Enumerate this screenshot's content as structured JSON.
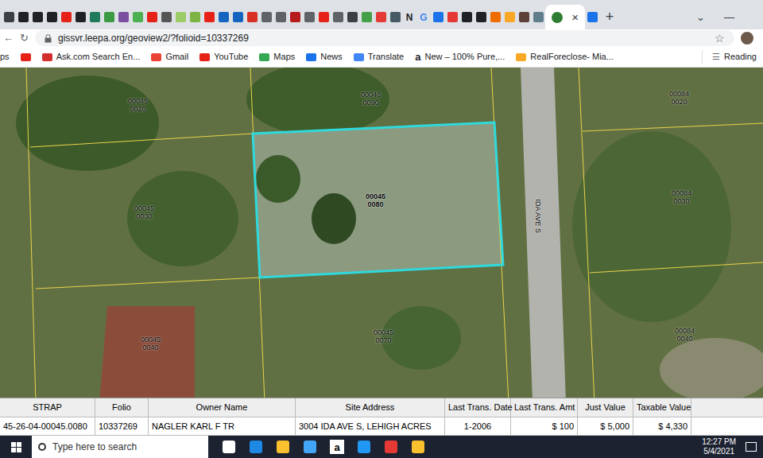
{
  "browser": {
    "tabs": [
      {
        "kind": "favicon",
        "glyph": "",
        "color": "#3c4043",
        "selected": false
      },
      {
        "kind": "favicon",
        "glyph": "",
        "color": "#202124",
        "selected": false
      },
      {
        "kind": "favicon",
        "glyph": "",
        "color": "#202124",
        "selected": false
      },
      {
        "kind": "favicon",
        "glyph": "",
        "color": "#202124",
        "selected": false
      },
      {
        "kind": "favicon",
        "glyph": "",
        "color": "#e62117",
        "selected": false
      },
      {
        "kind": "favicon",
        "glyph": "",
        "color": "#202124",
        "selected": false
      },
      {
        "kind": "favicon",
        "glyph": "",
        "color": "#1f7a5c",
        "selected": false
      },
      {
        "kind": "favicon",
        "glyph": "",
        "color": "#3b9a43",
        "selected": false
      },
      {
        "kind": "favicon",
        "glyph": "",
        "color": "#7b4fa0",
        "selected": false
      },
      {
        "kind": "favicon",
        "glyph": "",
        "color": "#4caf50",
        "selected": false
      },
      {
        "kind": "favicon",
        "glyph": "",
        "color": "#e62117",
        "selected": false
      },
      {
        "kind": "favicon",
        "glyph": "",
        "color": "#555555",
        "selected": false
      },
      {
        "kind": "favicon",
        "glyph": "",
        "color": "#9ccc65",
        "selected": false
      },
      {
        "kind": "favicon",
        "glyph": "",
        "color": "#7cb342",
        "selected": false
      },
      {
        "kind": "favicon",
        "glyph": "",
        "color": "#e62117",
        "selected": false
      },
      {
        "kind": "favicon",
        "glyph": "",
        "color": "#1565c0",
        "selected": false
      },
      {
        "kind": "favicon",
        "glyph": "",
        "color": "#1565c0",
        "selected": false
      },
      {
        "kind": "favicon",
        "glyph": "",
        "color": "#d93025",
        "selected": false
      },
      {
        "kind": "favicon",
        "glyph": "",
        "color": "#5f6368",
        "selected": false
      },
      {
        "kind": "favicon",
        "glyph": "",
        "color": "#5f6368",
        "selected": false
      },
      {
        "kind": "favicon",
        "glyph": "",
        "color": "#b71c1c",
        "selected": false
      },
      {
        "kind": "favicon",
        "glyph": "",
        "color": "#5f6368",
        "selected": false
      },
      {
        "kind": "favicon",
        "glyph": "",
        "color": "#e62117",
        "selected": false
      },
      {
        "kind": "favicon",
        "glyph": "",
        "color": "#5f6368",
        "selected": false
      },
      {
        "kind": "favicon",
        "glyph": "",
        "color": "#3c4043",
        "selected": false
      },
      {
        "kind": "favicon",
        "glyph": "",
        "color": "#43a047",
        "selected": false
      },
      {
        "kind": "favicon",
        "glyph": "",
        "color": "#e53935",
        "selected": false
      },
      {
        "kind": "favicon",
        "glyph": "",
        "color": "#455a64",
        "selected": false
      },
      {
        "kind": "letter",
        "glyph": "N",
        "color": "#202124",
        "selected": false
      },
      {
        "kind": "letter",
        "glyph": "G",
        "color": "#4285f4",
        "selected": false
      },
      {
        "kind": "favicon",
        "glyph": "",
        "color": "#1a73e8",
        "selected": false
      },
      {
        "kind": "favicon",
        "glyph": "",
        "color": "#e53935",
        "selected": false
      },
      {
        "kind": "favicon",
        "glyph": "",
        "color": "#202124",
        "selected": false
      },
      {
        "kind": "favicon",
        "glyph": "",
        "color": "#202124",
        "selected": false
      },
      {
        "kind": "favicon",
        "glyph": "",
        "color": "#ef6c00",
        "selected": false
      },
      {
        "kind": "favicon",
        "glyph": "",
        "color": "#f9a825",
        "selected": false
      },
      {
        "kind": "favicon",
        "glyph": "",
        "color": "#5d4037",
        "selected": false
      },
      {
        "kind": "favicon",
        "glyph": "",
        "color": "#607d8b",
        "selected": false
      },
      {
        "kind": "favicon",
        "glyph": "",
        "color": "#2e7d32",
        "selected": true
      },
      {
        "kind": "favicon",
        "glyph": "",
        "color": "#1a73e8",
        "selected": false
      }
    ],
    "close_glyph": "×",
    "new_tab": "+",
    "window_controls": [
      "⌄",
      "—"
    ]
  },
  "address_bar": {
    "url": "gissvr.leepa.org/geoview2/?folioid=10337269",
    "star": "☆"
  },
  "bookmarks": [
    {
      "kind": "text",
      "label": "ps",
      "color": "#5f6368"
    },
    {
      "kind": "icon",
      "label": "",
      "color": "#e62117"
    },
    {
      "kind": "icon",
      "label": "Ask.com Search En...",
      "color": "#d32f2f"
    },
    {
      "kind": "icon",
      "label": "Gmail",
      "color": "#ea4335"
    },
    {
      "kind": "icon",
      "label": "YouTube",
      "color": "#e62117"
    },
    {
      "kind": "icon",
      "label": "Maps",
      "color": "#34a853"
    },
    {
      "kind": "icon",
      "label": "News",
      "color": "#1a73e8"
    },
    {
      "kind": "icon",
      "label": "Translate",
      "color": "#4285f4"
    },
    {
      "kind": "letter",
      "label": "New – 100% Pure,...",
      "color": "#202124",
      "glyph": "a"
    },
    {
      "kind": "icon",
      "label": "RealForeclose- Mia...",
      "color": "#f9a825"
    }
  ],
  "reading_list": {
    "label": "Reading",
    "glyph": "☰"
  },
  "map": {
    "road_label": "IDA AVE S",
    "parcels": [
      {
        "lines": [
          "00045",
          "0020"
        ],
        "selected": false
      },
      {
        "lines": [
          "00046",
          "0090"
        ],
        "selected": false
      },
      {
        "lines": [
          "00045",
          "0030"
        ],
        "selected": false
      },
      {
        "lines": [
          "00045",
          "0080"
        ],
        "selected": true
      },
      {
        "lines": [
          "00045",
          "0040"
        ],
        "selected": false
      },
      {
        "lines": [
          "00045",
          "0070"
        ],
        "selected": false
      },
      {
        "lines": [
          "00084",
          "0020"
        ],
        "selected": false
      },
      {
        "lines": [
          "00084",
          "0030"
        ],
        "selected": false
      },
      {
        "lines": [
          "00084",
          "0040"
        ],
        "selected": false
      }
    ]
  },
  "table": {
    "columns": [
      "STRAP",
      "Folio",
      "Owner Name",
      "Site Address",
      "Last Trans. Date",
      "Last Trans. Amt",
      "Just Value",
      "Taxable Value"
    ],
    "rows": [
      [
        "45-26-04-00045.0080",
        "10337269",
        "NAGLER KARL F TR",
        "3004 IDA AVE S, LEHIGH ACRES",
        "1-2006",
        "$ 100",
        "$ 5,000",
        "$ 4,330"
      ]
    ]
  },
  "taskbar": {
    "search_placeholder": "Type here to search",
    "apps": [
      {
        "glyph": "",
        "color": "#ffffff"
      },
      {
        "glyph": "",
        "color": "#1e88e5"
      },
      {
        "glyph": "",
        "color": "#fbc02d"
      },
      {
        "glyph": "",
        "color": "#42a5f5"
      },
      {
        "glyph": "a",
        "color": "#ffffff"
      },
      {
        "glyph": "",
        "color": "#2196f3"
      },
      {
        "glyph": "",
        "color": "#e53935"
      },
      {
        "glyph": "",
        "color": "#fbc02d"
      }
    ],
    "time": "12:27 PM",
    "date": "5/4/2021"
  }
}
